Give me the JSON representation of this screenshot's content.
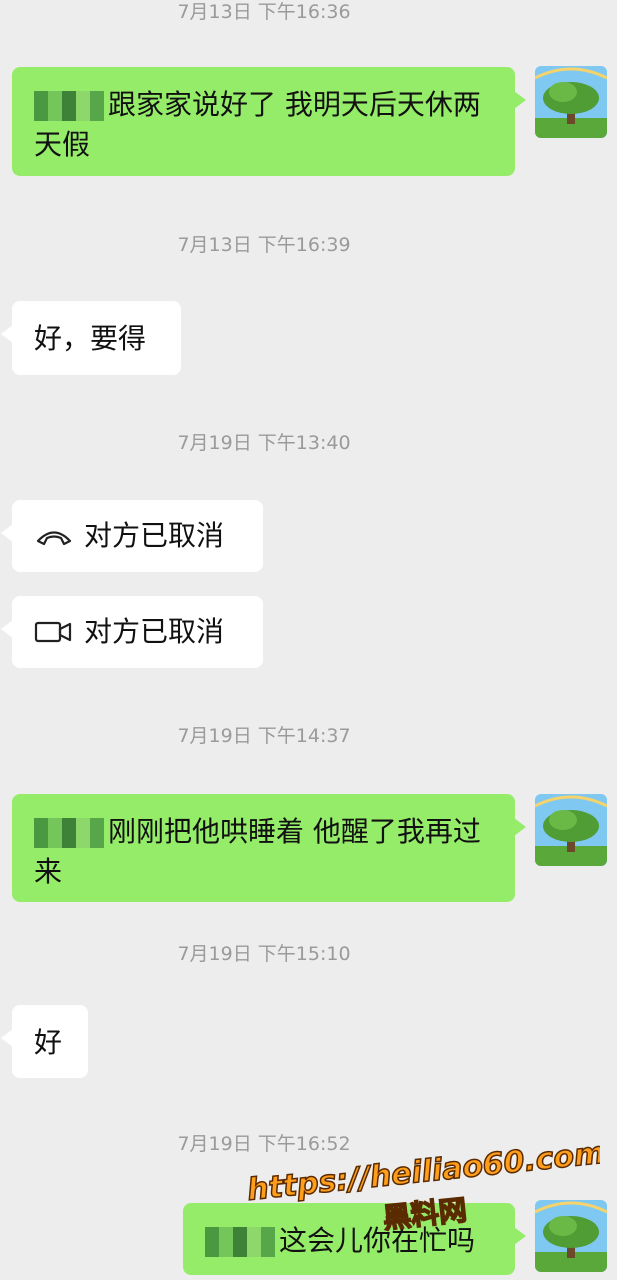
{
  "messages": [
    {
      "timestamp": "7月13日 下午16:36"
    },
    {
      "from": "me",
      "text": "跟家家说好了 我明天后天休两天假"
    },
    {
      "timestamp": "7月13日 下午16:39"
    },
    {
      "from": "them",
      "text": "好，要得"
    },
    {
      "timestamp": "7月19日 下午13:40"
    },
    {
      "from": "them",
      "type": "voice-call",
      "icon": "phone-hangup-icon",
      "text": "对方已取消"
    },
    {
      "from": "them",
      "type": "video-call",
      "icon": "video-camera-icon",
      "text": "对方已取消"
    },
    {
      "timestamp": "7月19日 下午14:37"
    },
    {
      "from": "me",
      "text": "刚刚把他哄睡着 他醒了我再过来"
    },
    {
      "timestamp": "7月19日 下午15:10"
    },
    {
      "from": "them",
      "text": "好"
    },
    {
      "timestamp": "7月19日 下午16:52"
    },
    {
      "from": "me",
      "text": "这会儿你在忙吗"
    }
  ],
  "watermark": {
    "url": "https://heiliao60.com",
    "name": "黑料网"
  },
  "colors": {
    "background": "#ededed",
    "my_bubble": "#95ec69",
    "their_bubble": "#ffffff",
    "timestamp": "#9a9a9a",
    "watermark": "#ff9e1b"
  }
}
